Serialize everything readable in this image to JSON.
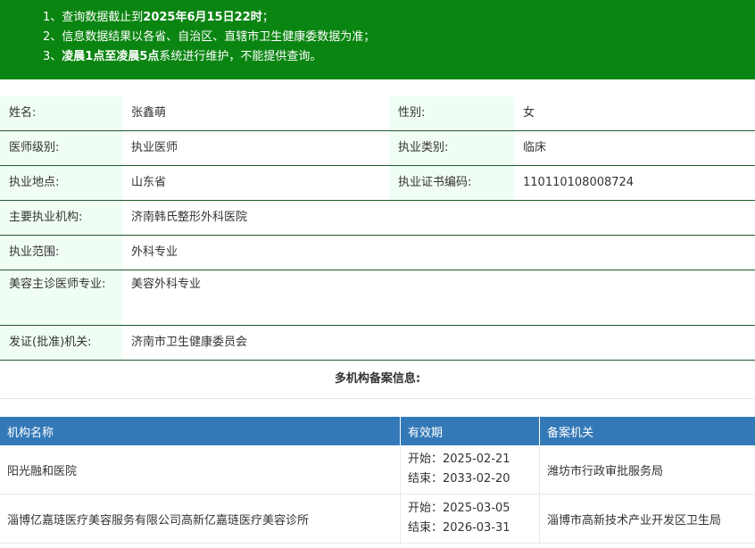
{
  "notice": {
    "line1_prefix": "1、查询数据截止到",
    "line1_bold": "2025年6月15日22时",
    "line1_suffix": "；",
    "line2": "2、信息数据结果以各省、自治区、直辖市卫生健康委数据为准；",
    "line3_prefix": "3、",
    "line3_bold": "凌晨1点至凌晨5点",
    "line3_suffix": "系统进行维护，不能提供查询。"
  },
  "info": {
    "name_label": "姓名:",
    "name": "张鑫萌",
    "gender_label": "性别:",
    "gender": "女",
    "level_label": "医师级别:",
    "level": "执业医师",
    "category_label": "执业类别:",
    "category": "临床",
    "location_label": "执业地点:",
    "location": "山东省",
    "cert_label": "执业证书编码:",
    "cert": "110110108008724",
    "institution_label": "主要执业机构:",
    "institution": "济南韩氏整形外科医院",
    "scope_label": "执业范围:",
    "scope": "外科专业",
    "cosmetic_label": "美容主诊医师专业:",
    "cosmetic": "美容外科专业",
    "issuer_label": "发证(批准)机关:",
    "issuer": "济南市卫生健康委员会"
  },
  "section_title": "多机构备案信息:",
  "table": {
    "headers": [
      "机构名称",
      "有效期",
      "备案机关"
    ],
    "rows": [
      {
        "org": "阳光融和医院",
        "start": "开始：2025-02-21",
        "end": "结束：2033-02-20",
        "authority": "潍坊市行政审批服务局"
      },
      {
        "org": "淄博亿嘉琏医疗美容服务有限公司高新亿嘉琏医疗美容诊所",
        "start": "开始：2025-03-05",
        "end": "结束：2026-03-31",
        "authority": "淄博市高新技术产业开发区卫生局"
      }
    ]
  }
}
